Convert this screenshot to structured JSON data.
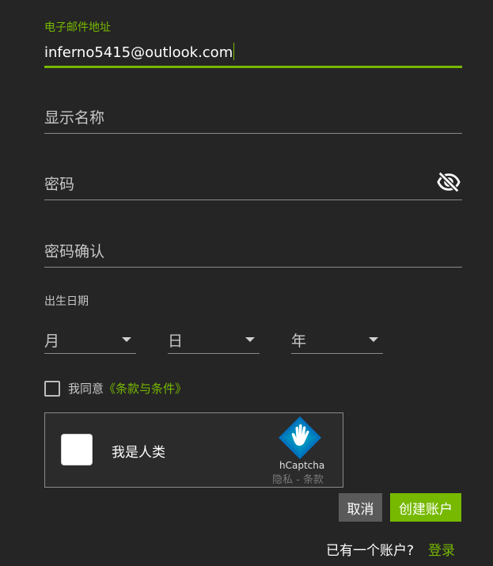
{
  "email": {
    "label": "电子邮件地址",
    "value": "inferno5415@outlook.com"
  },
  "display_name": {
    "placeholder": "显示名称"
  },
  "password": {
    "placeholder": "密码",
    "visibility_icon": "eye-off-icon"
  },
  "password_confirm": {
    "placeholder": "密码确认"
  },
  "birthdate": {
    "label": "出生日期",
    "month": "月",
    "day": "日",
    "year": "年"
  },
  "terms": {
    "prefix": "我同意",
    "link": "《条款与条件》"
  },
  "captcha": {
    "label": "我是人类",
    "brand": "hCaptcha",
    "privacy": "隐私",
    "separator": " - ",
    "terms": "条款"
  },
  "actions": {
    "cancel": "取消",
    "create": "创建账户"
  },
  "login": {
    "question": "已有一个账户?",
    "link": "登录"
  },
  "colors": {
    "accent": "#76b900",
    "background": "#252525",
    "cancel_bg": "#5a5a5a"
  }
}
